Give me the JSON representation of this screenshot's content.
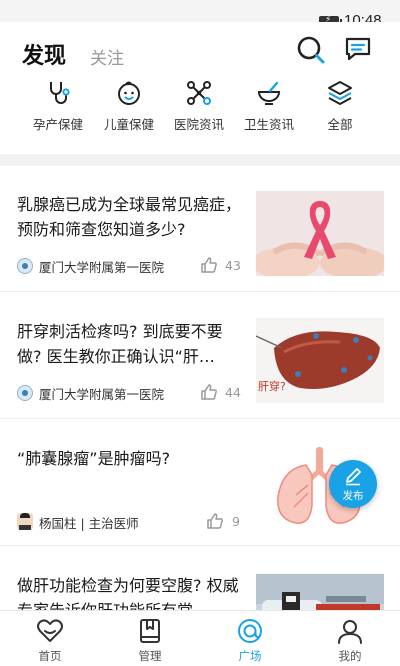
{
  "status_bar": {
    "time": "10:48"
  },
  "header": {
    "tab_discover": "发现",
    "tab_follow": "关注",
    "search_icon": "search-icon",
    "message_icon": "message-icon"
  },
  "categories": [
    {
      "label": "孕产保健",
      "icon": "stethoscope-icon"
    },
    {
      "label": "儿童保健",
      "icon": "baby-face-icon"
    },
    {
      "label": "医院资讯",
      "icon": "network-icon"
    },
    {
      "label": "卫生资讯",
      "icon": "mortar-bowl-icon"
    },
    {
      "label": "全部",
      "icon": "layers-icon"
    }
  ],
  "articles": [
    {
      "title": "乳腺癌已成为全球最常见癌症，预防和筛查您知道多少?",
      "source": "厦门大学附属第一医院",
      "likes": "43",
      "thumb": "pink-ribbon-hands"
    },
    {
      "title": "肝穿刺活检疼吗? 到底要不要做? 医生教你正确认识“肝…",
      "source": "厦门大学附属第一医院",
      "likes": "44",
      "thumb": "liver-illustration",
      "thumb_caption": "肝穿?"
    },
    {
      "title": "“肺囊腺瘤”是肿瘤吗?",
      "source": "杨国柱 | 主治医师",
      "likes": "9",
      "thumb": "lungs-illustration"
    },
    {
      "title": "做肝功能检查为何要空腹? 权威专家告诉你肝功能所有常",
      "thumb": "lab-photo"
    }
  ],
  "fab": {
    "label": "发布",
    "icon": "pen-icon"
  },
  "tabbar": [
    {
      "label": "首页",
      "icon": "heart-icon",
      "active": false
    },
    {
      "label": "管理",
      "icon": "book-icon",
      "active": false
    },
    {
      "label": "广场",
      "icon": "at-swirl-icon",
      "active": true
    },
    {
      "label": "我的",
      "icon": "person-icon",
      "active": false
    }
  ],
  "colors": {
    "accent": "#1aa2e6",
    "ribbon": "#e84a6f",
    "liver": "#9c3a2c"
  }
}
